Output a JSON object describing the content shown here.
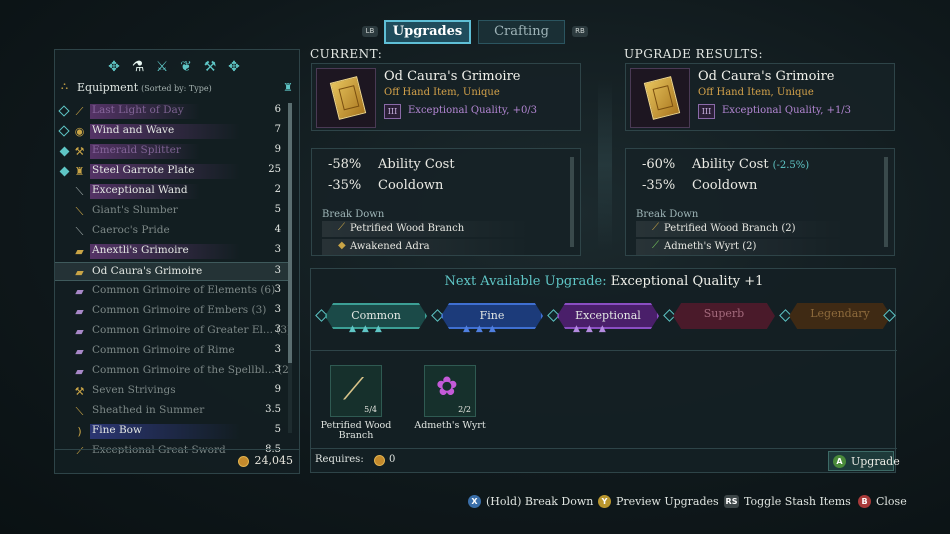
{
  "tabs": {
    "lb": "LB",
    "rb": "RB",
    "upgrades": "Upgrades",
    "crafting": "Crafting"
  },
  "categories": [
    {
      "icon": "shard-icon"
    },
    {
      "icon": "flask-icon"
    },
    {
      "icon": "crossed-weapons-icon"
    },
    {
      "icon": "leaf-icon"
    },
    {
      "icon": "anvil-icon"
    },
    {
      "icon": "gem-icon"
    }
  ],
  "equipment": {
    "title": "Equipment",
    "sort": "(Sorted by: Type)",
    "items": [
      {
        "name": "Last Light of Day",
        "count": "6"
      },
      {
        "name": "Wind and Wave",
        "count": "7"
      },
      {
        "name": "Emerald Splitter",
        "count": "9"
      },
      {
        "name": "Steel Garrote Plate",
        "count": "25"
      },
      {
        "name": "Exceptional Wand",
        "count": "2"
      },
      {
        "name": "Giant's Slumber",
        "count": "5"
      },
      {
        "name": "Caeroc's Pride",
        "count": "4"
      },
      {
        "name": "Anextli's Grimoire",
        "count": "3"
      },
      {
        "name": "Od Caura's Grimoire",
        "count": "3"
      },
      {
        "name": "Common Grimoire of Elements (6)",
        "count": "3"
      },
      {
        "name": "Common Grimoire of Embers (3)",
        "count": "3"
      },
      {
        "name": "Common Grimoire of Greater El... (3)",
        "count": "3"
      },
      {
        "name": "Common Grimoire of Rime",
        "count": "3"
      },
      {
        "name": "Common Grimoire of the Spellbl... (2)",
        "count": "3"
      },
      {
        "name": "Seven Strivings",
        "count": "9"
      },
      {
        "name": "Sheathed in Summer",
        "count": "3.5"
      },
      {
        "name": "Fine Bow",
        "count": "5"
      },
      {
        "name": "Exceptional Great Sword",
        "count": "8.5"
      }
    ],
    "gold": "24,045"
  },
  "current": {
    "label": "CURRENT:",
    "name": "Od Caura's Grimoire",
    "type": "Off Hand Item, Unique",
    "tier": "III",
    "quality": "Exceptional Quality, +0/3",
    "stat1_val": "-58%",
    "stat1_name": "Ability Cost",
    "stat2_val": "-35%",
    "stat2_name": "Cooldown",
    "breakdown_label": "Break Down",
    "breakdown": [
      "Petrified Wood Branch",
      "Awakened Adra"
    ]
  },
  "result": {
    "label": "UPGRADE RESULTS:",
    "name": "Od Caura's Grimoire",
    "type": "Off Hand Item, Unique",
    "tier": "III",
    "quality": "Exceptional Quality, +1/3",
    "stat1_val": "-60%",
    "stat1_name": "Ability Cost",
    "stat1_delta": "(-2.5%)",
    "stat2_val": "-35%",
    "stat2_name": "Cooldown",
    "breakdown_label": "Break Down",
    "breakdown": [
      "Petrified Wood Branch (2)",
      "Admeth's Wyrt (2)"
    ]
  },
  "upgrade": {
    "next_label": "Next Available Upgrade:",
    "next_value": "Exceptional Quality +1",
    "tiers": [
      "Common",
      "Fine",
      "Exceptional",
      "Superb",
      "Legendary"
    ],
    "materials": [
      {
        "name": "Petrified Wood Branch",
        "count": "5/4"
      },
      {
        "name": "Admeth's Wyrt",
        "count": "2/2"
      }
    ],
    "requires_label": "Requires:",
    "requires_value": "0",
    "button_key": "A",
    "button_label": "Upgrade"
  },
  "hints": [
    {
      "key": "X",
      "label": "(Hold) Break Down"
    },
    {
      "key": "Y",
      "label": "Preview Upgrades"
    },
    {
      "key": "RS",
      "label": "Toggle Stash Items"
    },
    {
      "key": "B",
      "label": "Close"
    }
  ]
}
